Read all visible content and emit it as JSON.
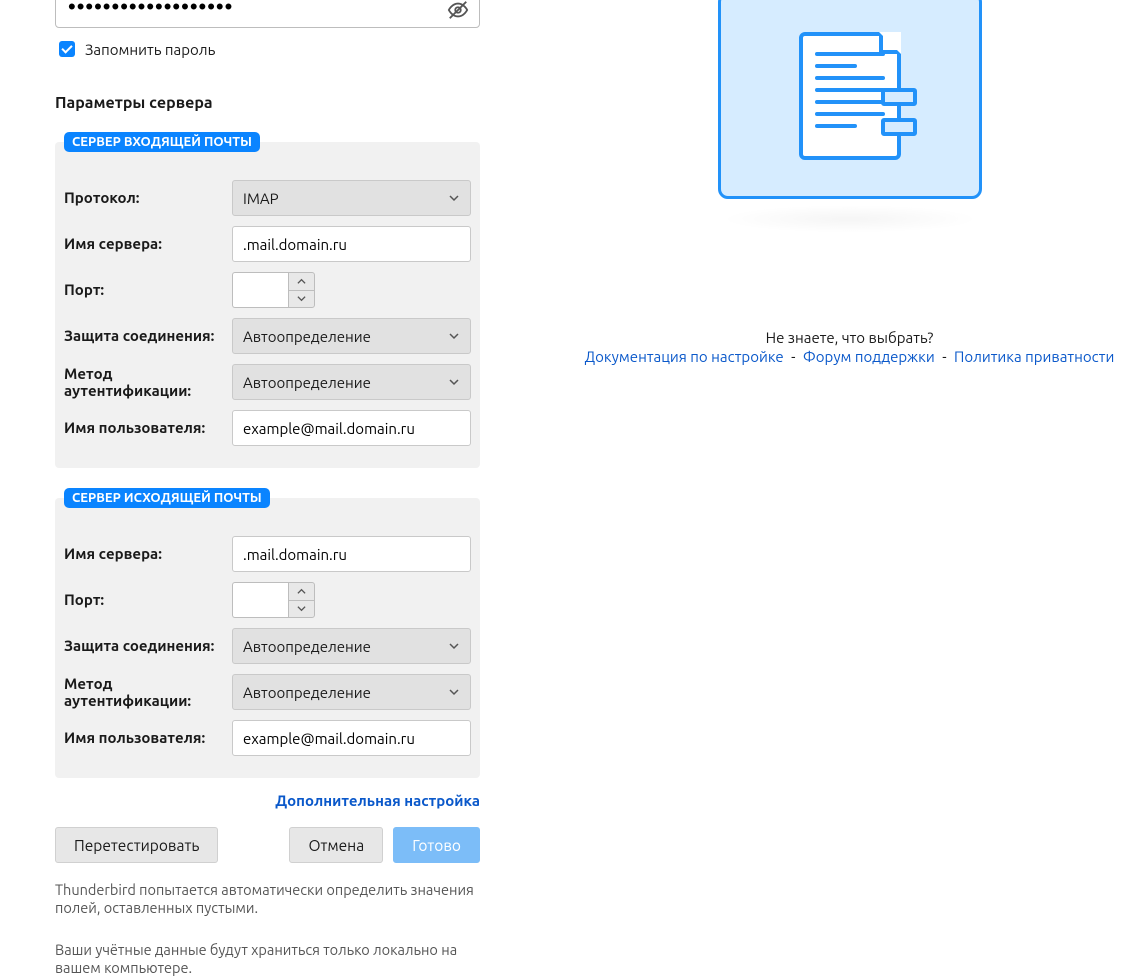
{
  "password": {
    "value": "•••••••••••••••••••"
  },
  "remember_label": "Запомнить пароль",
  "section_title": "Параметры сервера",
  "incoming": {
    "legend": "СЕРВЕР ВХОДЯЩЕЙ ПОЧТЫ",
    "protocol_label": "Протокол:",
    "protocol_value": "IMAP",
    "host_label": "Имя сервера:",
    "host_value": ".mail.domain.ru",
    "port_label": "Порт:",
    "port_value": "",
    "security_label": "Защита соединения:",
    "security_value": "Автоопределение",
    "auth_label": "Метод аутентификации:",
    "auth_value": "Автоопределение",
    "user_label": "Имя пользователя:",
    "user_value": "example@mail.domain.ru"
  },
  "outgoing": {
    "legend": "СЕРВЕР ИСХОДЯЩЕЙ ПОЧТЫ",
    "host_label": "Имя сервера:",
    "host_value": ".mail.domain.ru",
    "port_label": "Порт:",
    "port_value": "",
    "security_label": "Защита соединения:",
    "security_value": "Автоопределение",
    "auth_label": "Метод аутентификации:",
    "auth_value": "Автоопределение",
    "user_label": "Имя пользователя:",
    "user_value": "example@mail.domain.ru"
  },
  "advanced_link": "Дополнительная настройка",
  "buttons": {
    "retest": "Перетестировать",
    "cancel": "Отмена",
    "done": "Готово"
  },
  "note1": "Thunderbird попытается автоматически определить значения полей, оставленных пустыми.",
  "note2": "Ваши учётные данные будут храниться только локально на вашем компьютере.",
  "help": {
    "text": "Не знаете, что выбрать?",
    "doc": "Документация по настройке",
    "forum": "Форум поддержки",
    "privacy": "Политика приватности",
    "sep": "-"
  }
}
